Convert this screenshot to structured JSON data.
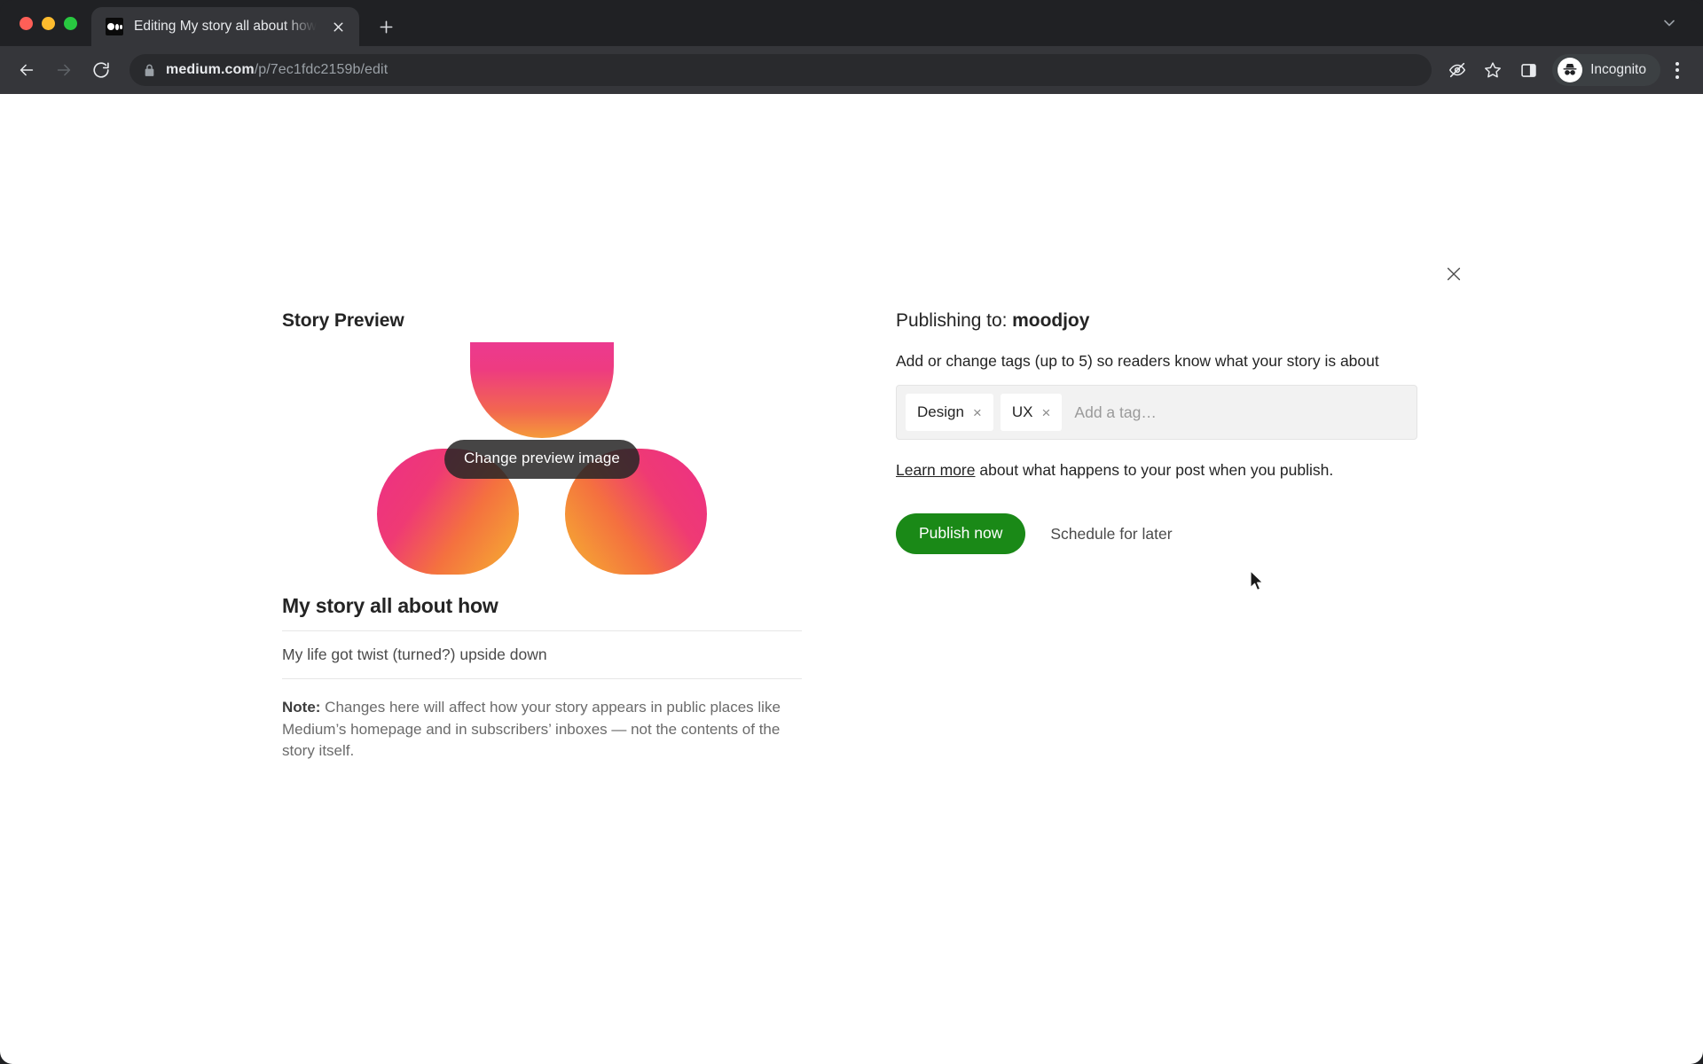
{
  "browser": {
    "tab": {
      "title": "Editing My story all about how",
      "favicon": "medium-logo-icon",
      "close_icon": "close-icon"
    },
    "new_tab_icon": "plus-icon",
    "tab_list_icon": "chevron-down-icon",
    "nav": {
      "back_icon": "arrow-left-icon",
      "forward_icon": "arrow-right-icon",
      "reload_icon": "reload-icon"
    },
    "omnibox": {
      "lock_icon": "lock-icon",
      "host": "medium.com",
      "path": "/p/7ec1fdc2159b/edit"
    },
    "toolbar_icons": {
      "no_tracking": "eye-slash-icon",
      "bookmark": "star-icon",
      "side_panel": "side-panel-icon",
      "menu": "three-dots-icon"
    },
    "profile": {
      "label": "Incognito",
      "avatar_icon": "incognito-hat-icon"
    }
  },
  "page": {
    "close_icon": "close-icon",
    "preview": {
      "heading": "Story Preview",
      "image_tooltip": "Change preview image",
      "title": "My story all about how",
      "subtitle": "My life got twist (turned?) upside down",
      "note_label": "Note:",
      "note_body": " Changes here will affect how your story appears in public places like Medium’s homepage and in subscribers’ inboxes — not the contents of the story itself."
    },
    "publishing": {
      "publishing_to_label": "Publishing to: ",
      "publication": "moodjoy",
      "tags_help": "Add or change tags (up to 5) so readers know what your story is about",
      "tags": [
        {
          "label": "Design",
          "remove_icon": "close-icon"
        },
        {
          "label": "UX",
          "remove_icon": "close-icon"
        }
      ],
      "tag_placeholder": "Add a tag…",
      "learn_more_link": "Learn more",
      "learn_more_rest": " about what happens to your post when you publish.",
      "publish_now_label": "Publish now",
      "schedule_later_label": "Schedule for later",
      "accent_green": "#1a8917"
    }
  },
  "cursor": {
    "icon": "arrow-pointer-icon"
  }
}
